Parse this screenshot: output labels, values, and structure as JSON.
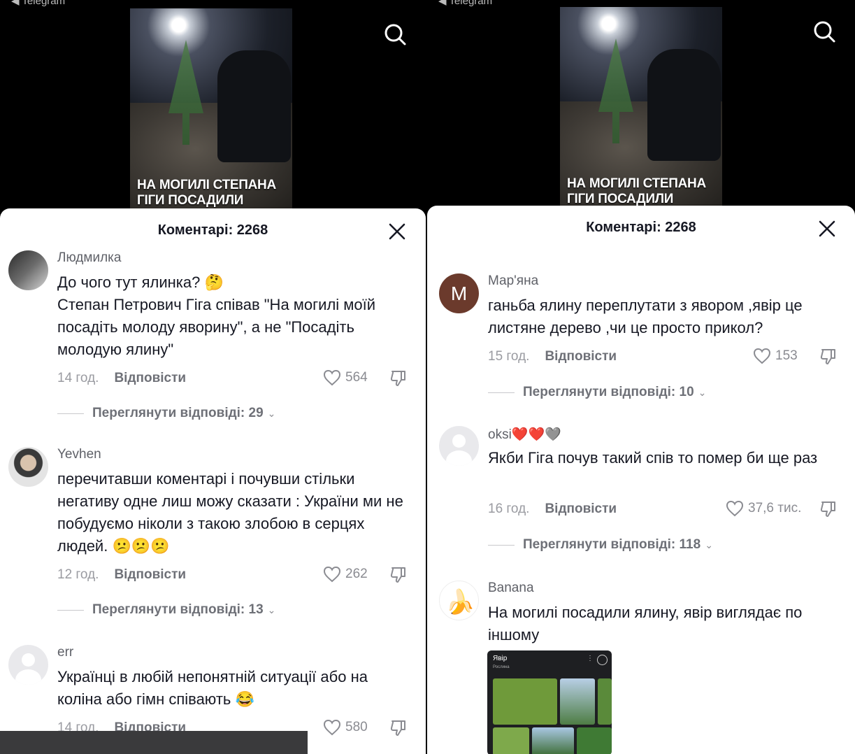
{
  "left": {
    "back_label": "◀ Telegram",
    "video_caption_line1": "НА МОГИЛІ СТЕПАНА",
    "video_caption_line2": "ГІГИ ПОСАДИЛИ",
    "comments_title": "Коментарі: 2268",
    "comments": [
      {
        "username": "Людмилка",
        "text": "До чого тут ялинка? 🤔\nСтепан Петрович Гіга співав \"На могилі моїй посадіть молоду яворину\", а не \"Посадіть молодую ялину\"",
        "time": "14 год.",
        "reply_label": "Відповісти",
        "likes": "564",
        "view_replies": "Переглянути відповіді: 29"
      },
      {
        "username": "Yevhen",
        "text": "перечитавши коментарі і почувши стільки негативу одне лиш можу сказати : України ми не побудуємо ніколи з такою злобою в серцях людей. 😕😕😕",
        "time": "12 год.",
        "reply_label": "Відповісти",
        "likes": "262",
        "view_replies": "Переглянути відповіді: 13"
      },
      {
        "username": "err",
        "text": "Українці в любій непонятній ситуації або на коліна або гімн співають 😂",
        "time": "14 год.",
        "reply_label": "Відповісти",
        "likes": "580"
      }
    ]
  },
  "right": {
    "back_label": "◀ Telegram",
    "video_caption_line1": "НА МОГИЛІ СТЕПАНА",
    "video_caption_line2": "ГІГИ ПОСАДИЛИ",
    "comments_title": "Коментарі: 2268",
    "comments": [
      {
        "avatar_letter": "M",
        "username": "Мар'яна",
        "text": "ганьба ялину переплутати з явором ,явір це листяне дерево ,чи це просто прикол?",
        "time": "15 год.",
        "reply_label": "Відповісти",
        "likes": "153",
        "view_replies": "Переглянути відповіді: 10"
      },
      {
        "username": "oksi❤️❤️🩶",
        "text": "Якби Гіга почув такий спів то помер би ще раз",
        "time": "16 год.",
        "reply_label": "Відповісти",
        "likes": "37,6 тис.",
        "view_replies": "Переглянути відповіді: 118"
      },
      {
        "username": "Banana",
        "text": "На могилі посадили ялину, явір виглядає по іншому",
        "attachment": {
          "title": "Явір",
          "subtitle": "Рослина"
        }
      }
    ]
  }
}
